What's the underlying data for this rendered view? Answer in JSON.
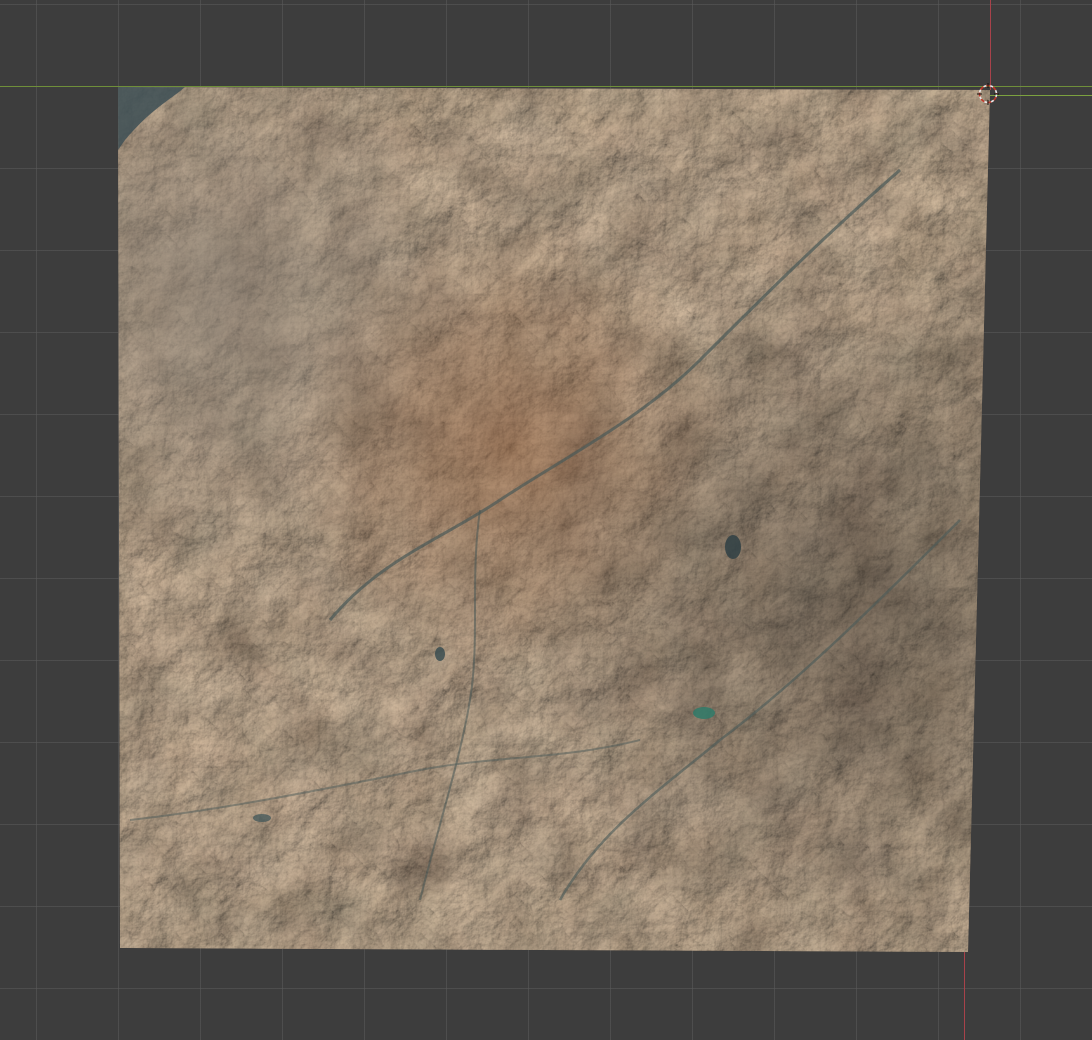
{
  "viewport": {
    "view": "3d-viewport-top",
    "background_color": "#3d3d3d",
    "grid_color": "#595959",
    "x_axis_color": "#7ca13f",
    "y_axis_color": "#a8424a"
  },
  "scene": {
    "objects": [
      {
        "type": "plane",
        "material": "terrain-satellite-texture",
        "selected": false
      }
    ],
    "cursor": {
      "icon": "3d-cursor-icon"
    }
  },
  "terrain_palette": {
    "base": "#5a4f45",
    "dark": "#3b3631",
    "rust": "#7a5238",
    "pale": "#7d756b",
    "water": "#3f5a5e",
    "lake": "#2f7a68"
  }
}
